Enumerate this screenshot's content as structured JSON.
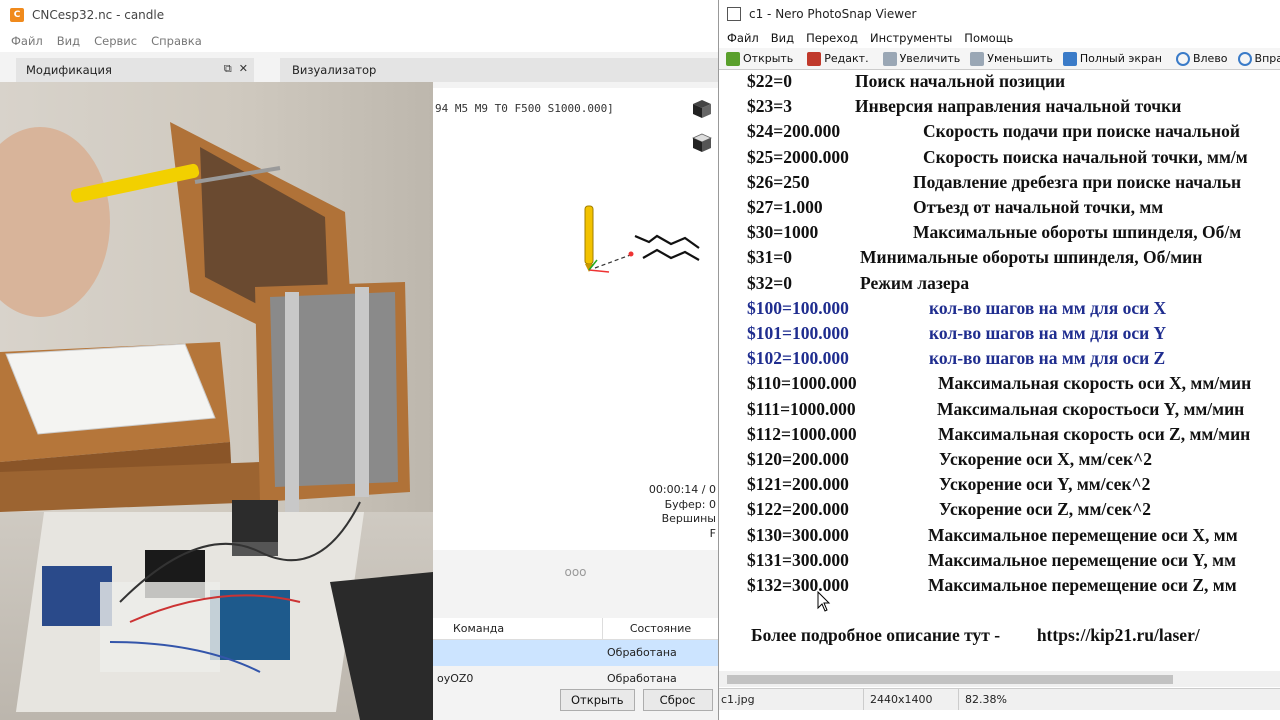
{
  "candle": {
    "title": "CNCesp32.nc - candle",
    "menu": [
      "Файл",
      "Вид",
      "Сервис",
      "Справка"
    ],
    "dock_modification": "Модификация",
    "dock_visualizer": "Визуализатор",
    "gcode_line": "94 M5 M9 T0 F500 S1000.000]",
    "status": {
      "time": "00:00:14 / 0",
      "buffer": "Буфер: 0",
      "vertices": "Вершины",
      "f": "F"
    },
    "splitter": "ooo",
    "table": {
      "col_command": "Команда",
      "col_state": "Состояние",
      "rows": [
        {
          "command": "",
          "state": "Обработана"
        },
        {
          "command": "oyOZ0",
          "state": "Обработана"
        }
      ]
    },
    "buttons": {
      "open": "Открыть",
      "reset": "Сброс"
    },
    "accent_color": "#f08a1c"
  },
  "nero": {
    "title": "c1 - Nero PhotoSnap Viewer",
    "menu": [
      "Файл",
      "Вид",
      "Переход",
      "Инструменты",
      "Помощь"
    ],
    "toolbar": [
      "Открыть",
      "Редакт.",
      "Увеличить",
      "Уменьшить",
      "Полный экран",
      "Влево",
      "Вправо"
    ],
    "params": [
      {
        "key": "$22=0",
        "desc": "Поиск начальной позиции",
        "blue": false
      },
      {
        "key": "$23=3",
        "desc": "Инверсия направления начальной точки",
        "blue": false
      },
      {
        "key": "$24=200.000",
        "desc": "Скорость подачи при поиске начальной",
        "blue": false
      },
      {
        "key": "$25=2000.000",
        "desc": "Скорость поиска начальной точки, мм/м",
        "blue": false
      },
      {
        "key": "$26=250",
        "desc": "Подавление дребезга при поиске начальн",
        "blue": false
      },
      {
        "key": "$27=1.000",
        "desc": "Отъезд от начальной точки, мм",
        "blue": false
      },
      {
        "key": "$30=1000",
        "desc": "Максимальные обороты шпинделя, Об/м",
        "blue": false
      },
      {
        "key": "$31=0",
        "desc": "Минимальные обороты шпинделя, Об/мин",
        "blue": false
      },
      {
        "key": "$32=0",
        "desc": "Режим лазера",
        "blue": false
      },
      {
        "key": "$100=100.000",
        "desc": "кол-во шагов на мм для оси X",
        "blue": true
      },
      {
        "key": "$101=100.000",
        "desc": "кол-во шагов на мм для оси Y",
        "blue": true
      },
      {
        "key": "$102=100.000",
        "desc": "кол-во шагов на мм для оси Z",
        "blue": true
      },
      {
        "key": "$110=1000.000",
        "desc": "Максимальная скорость оси X, мм/мин",
        "blue": false
      },
      {
        "key": "$111=1000.000",
        "desc": "Максимальная скоростьоси Y, мм/мин",
        "blue": false
      },
      {
        "key": "$112=1000.000",
        "desc": "Максимальная скорость оси Z, мм/мин",
        "blue": false
      },
      {
        "key": "$120=200.000",
        "desc": "Ускорение оси X, мм/сек^2",
        "blue": false
      },
      {
        "key": "$121=200.000",
        "desc": "Ускорение оси Y, мм/сек^2",
        "blue": false
      },
      {
        "key": "$122=200.000",
        "desc": "Ускорение оси Z, мм/сек^2",
        "blue": false
      },
      {
        "key": "$130=300.000",
        "desc": "Максимальное перемещение  оси X, мм",
        "blue": false
      },
      {
        "key": "$131=300.000",
        "desc": "Максимальное перемещение оси Y, мм",
        "blue": false
      },
      {
        "key": "$132=300.000",
        "desc": "Максимальное перемещение оси Z, мм",
        "blue": false
      }
    ],
    "footer_text": "Более подробное описание тут  -",
    "footer_link": "https://kip21.ru/laser/",
    "status": {
      "file": "c1.jpg",
      "dims": "2440x1400",
      "zoom": "82.38%"
    },
    "blue_color": "#1f2d8f"
  }
}
